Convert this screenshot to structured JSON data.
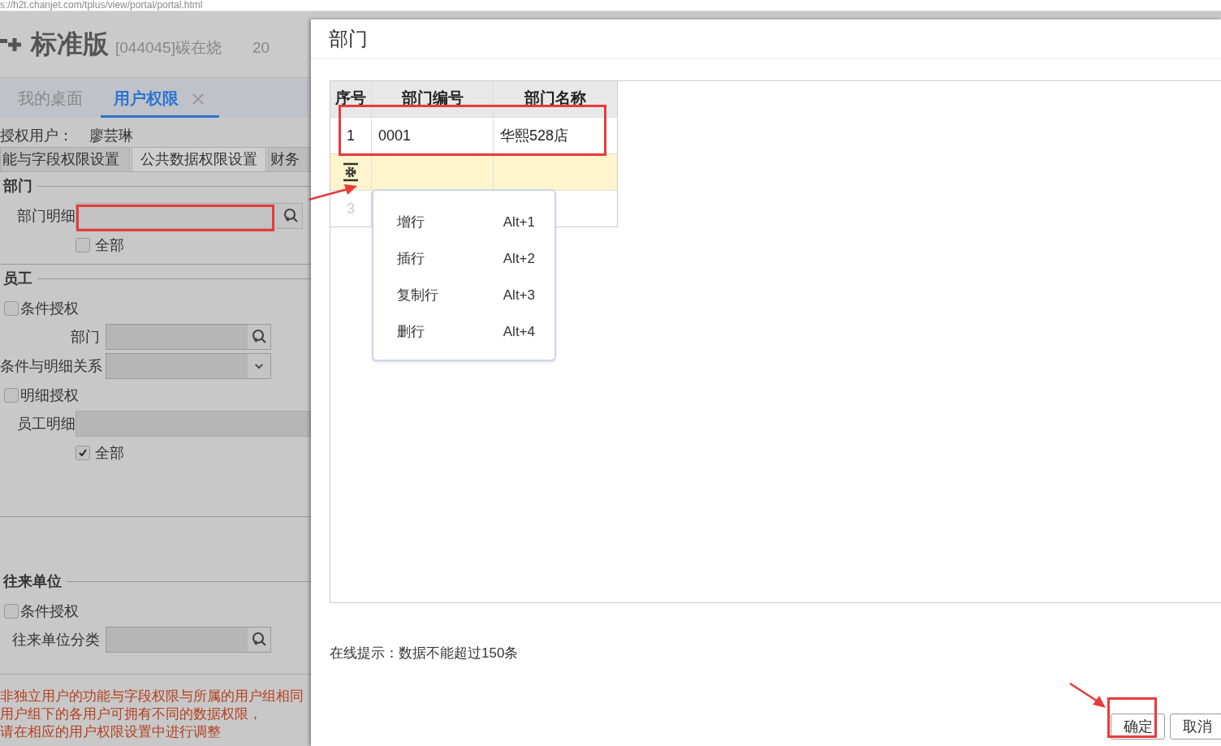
{
  "address_bar": {
    "url": "s://h2t.chanjet.com/tplus/view/portal/portal.html"
  },
  "app": {
    "product": "标准版",
    "account": "[044045]碳在烧",
    "date": "20",
    "tabs": [
      {
        "label": "我的桌面",
        "selected": false,
        "closable": false
      },
      {
        "label": "用户权限",
        "selected": true,
        "closable": true
      }
    ],
    "user_label": "授权用户：",
    "user_name": "廖芸琳",
    "subtabs": [
      {
        "label": "能与字段权限设置",
        "selected": false
      },
      {
        "label": "公共数据权限设置",
        "selected": true
      },
      {
        "label": "财务",
        "selected": false
      }
    ],
    "sections": [
      {
        "title": "部门",
        "divider_after": true,
        "items": [
          {
            "kind": "field",
            "label": "部门明细",
            "button": {
              "kind": "search"
            },
            "wide": true
          },
          {
            "kind": "checkbox",
            "label": "全部",
            "checked": false,
            "indent": true
          }
        ]
      },
      {
        "title": "员工",
        "divider_after": true,
        "items": [
          {
            "kind": "checkbox",
            "label": "条件授权",
            "checked": false,
            "indent": false
          },
          {
            "kind": "field",
            "label": "部门",
            "button": {
              "kind": "search"
            },
            "wide": false
          },
          {
            "kind": "field",
            "label": "条件与明细关系",
            "button": {
              "kind": "dropdown"
            },
            "wide": false
          },
          {
            "kind": "checkbox",
            "label": "明细授权",
            "checked": false,
            "indent": false
          },
          {
            "kind": "field",
            "label": "员工明细",
            "wide": true
          },
          {
            "kind": "checkbox",
            "label": "全部",
            "checked": true,
            "indent": true
          }
        ]
      },
      {
        "title": "往来单位",
        "divider_after": false,
        "items": [
          {
            "kind": "checkbox",
            "label": "条件授权",
            "checked": false,
            "indent": false
          },
          {
            "kind": "field",
            "label": "往来单位分类",
            "button": {
              "kind": "search"
            },
            "wide": false
          }
        ]
      }
    ],
    "note": [
      "非独立用户的功能与字段权限与所属的用户组相同",
      "用户组下的各用户可拥有不同的数据权限，",
      "请在相应的用户权限设置中进行调整"
    ]
  },
  "dialog": {
    "title": "部门",
    "table": {
      "columns": [
        "序号",
        "部门编号",
        "部门名称"
      ],
      "rows": [
        {
          "kind": "filled",
          "selected": false,
          "number": "1",
          "code": "0001",
          "name": "华熙528店"
        },
        {
          "kind": "filled",
          "selected": true
        },
        {
          "kind": "blank",
          "selected": false,
          "number": "3"
        }
      ]
    },
    "context_menu": [
      {
        "label": "增行",
        "shortcut": "Alt+1"
      },
      {
        "label": "插行",
        "shortcut": "Alt+2"
      },
      {
        "label": "复制行",
        "shortcut": "Alt+3"
      },
      {
        "label": "删行",
        "shortcut": "Alt+4"
      }
    ],
    "hint": "在线提示：数据不能超过150条",
    "buttons": [
      "确定",
      "取消"
    ]
  }
}
